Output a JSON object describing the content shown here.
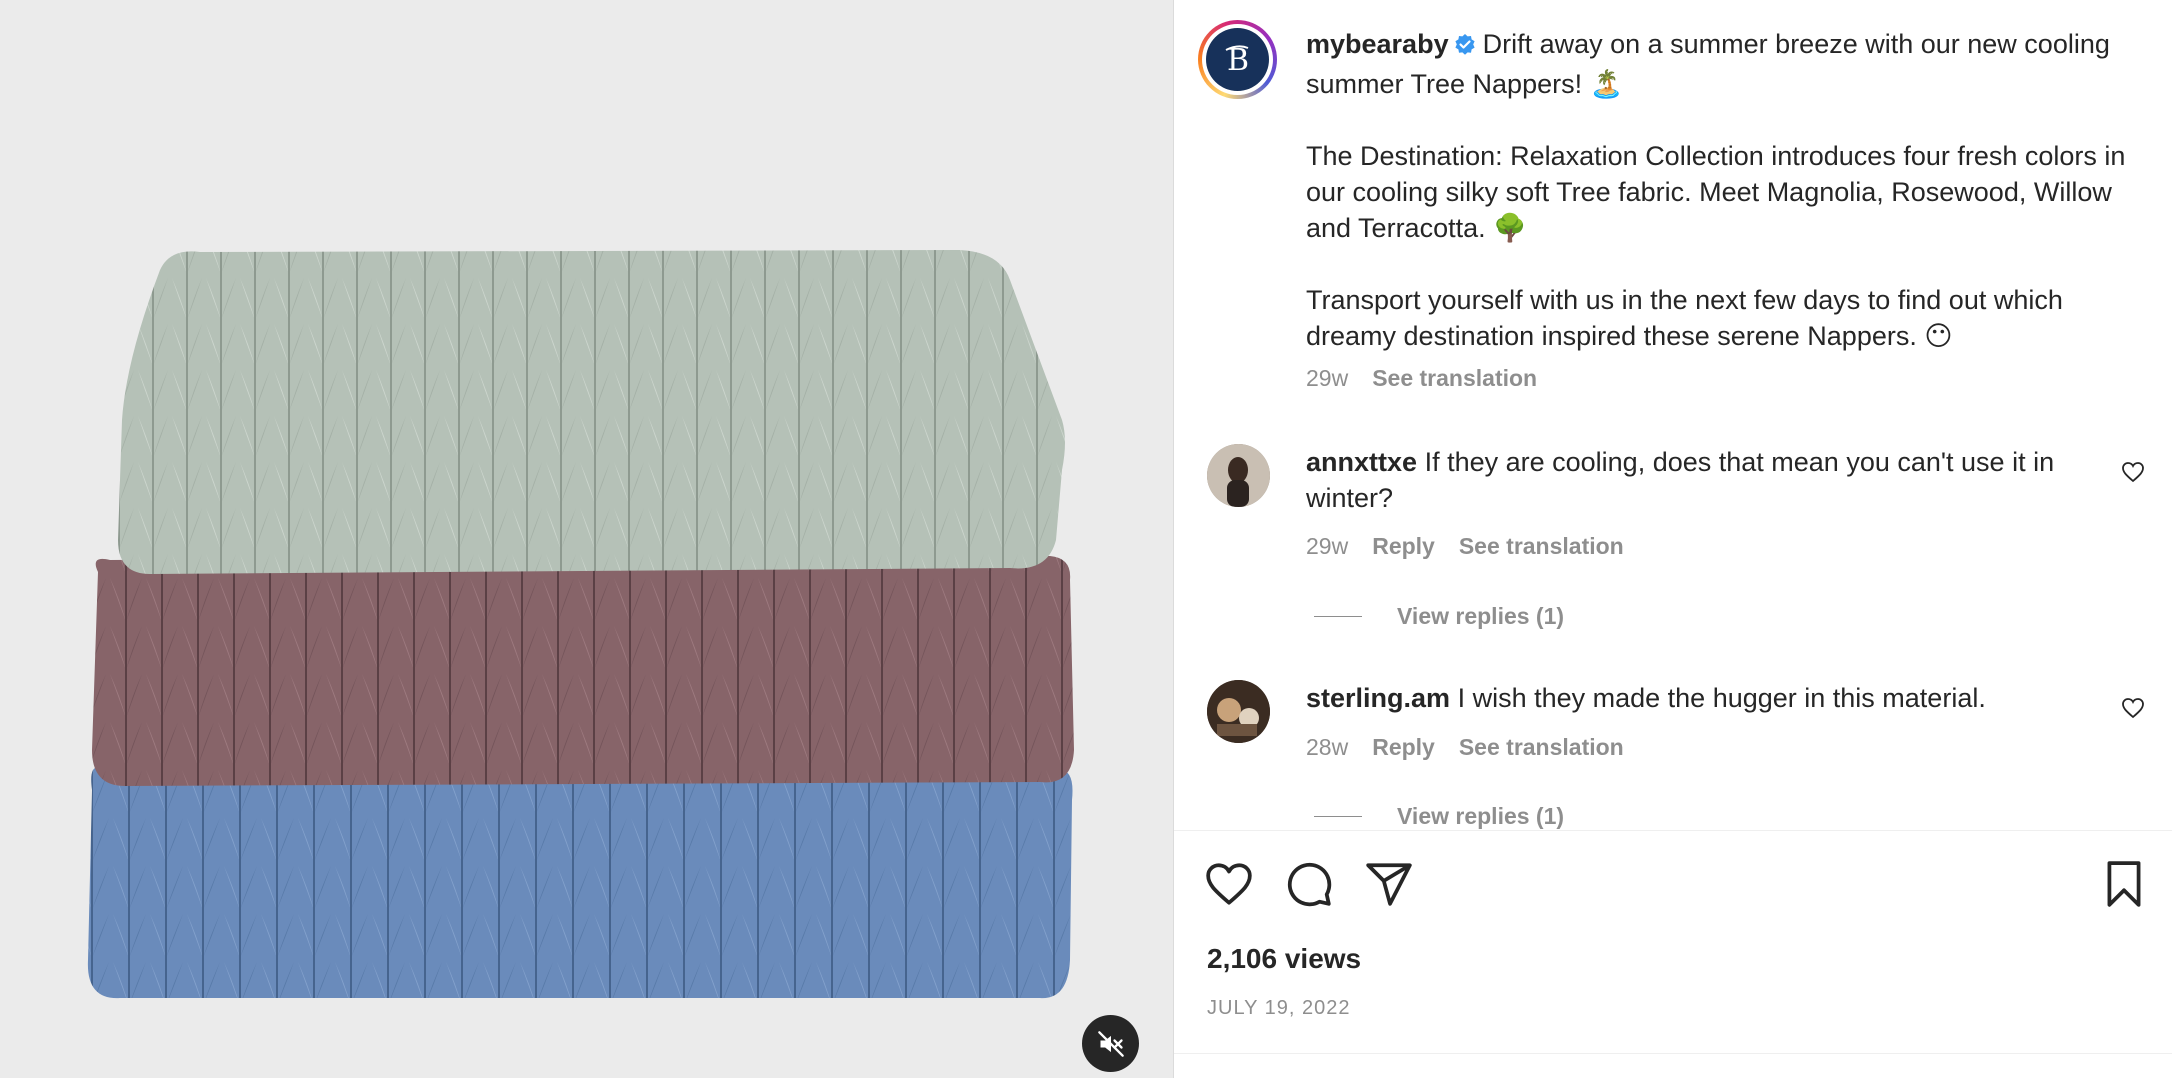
{
  "post": {
    "username": "mybearaby",
    "verified_icon": "verified-badge-icon",
    "caption_line1": "Drift away on a summer breeze with our new cooling summer Tree Nappers! 🏝️",
    "caption_para2": "The Destination: Relaxation Collection introduces four fresh colors in our cooling silky soft Tree fabric. Meet Magnolia, Rosewood, Willow and Terracotta. 🌳",
    "caption_para3": "Transport yourself with us in the next few days to find out which dreamy destination inspired these serene Nappers. 😶",
    "time": "29w",
    "see_translation": "See translation"
  },
  "comments": [
    {
      "username": "annxttxe",
      "text": "If they are cooling, does that mean you can't use it in winter?",
      "time": "29w",
      "reply": "Reply",
      "see_translation": "See translation",
      "view_replies": "View replies (1)"
    },
    {
      "username": "sterling.am",
      "text": "I wish they made the hugger in this material.",
      "time": "28w",
      "reply": "Reply",
      "see_translation": "See translation",
      "view_replies": "View replies (1)"
    }
  ],
  "footer": {
    "views": "2,106 views",
    "date": "JULY 19, 2022"
  },
  "media": {
    "colors": {
      "top": "#b9c4bb",
      "middle": "#8c6a70",
      "bottom": "#6e8fbf"
    },
    "mute_icon": "speaker-muted-icon"
  }
}
